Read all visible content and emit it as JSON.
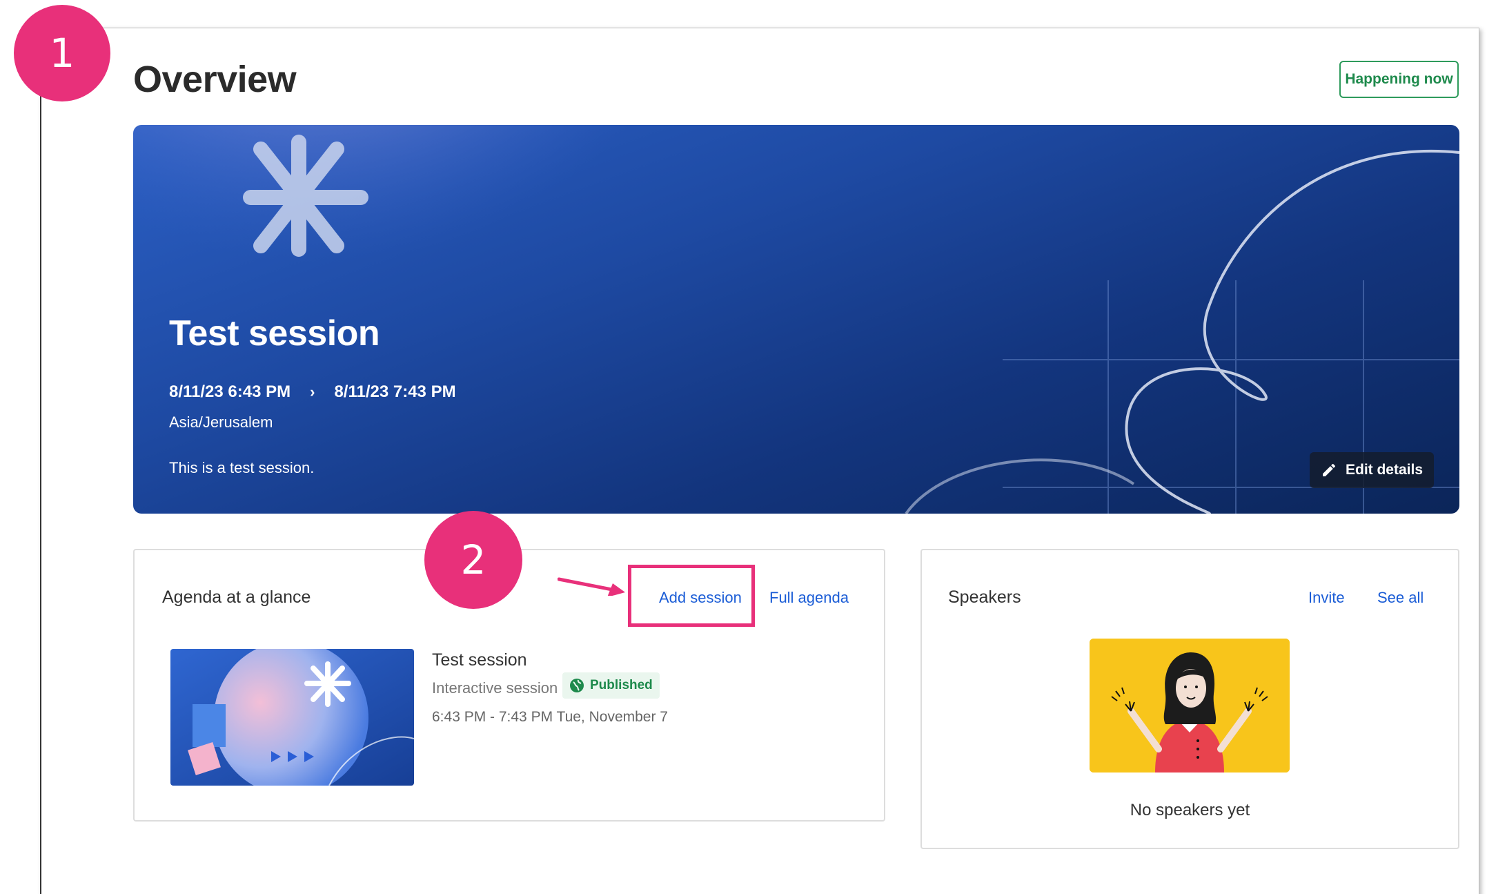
{
  "callouts": [
    "1",
    "2"
  ],
  "page": {
    "title": "Overview",
    "status_badge": "Happening now"
  },
  "banner": {
    "title": "Test session",
    "start": "8/11/23 6:43 PM",
    "end": "8/11/23 7:43 PM",
    "timezone": "Asia/Jerusalem",
    "description": "This is a test session.",
    "edit_label": "Edit details"
  },
  "agenda": {
    "title": "Agenda at a glance",
    "add_session_label": "Add session",
    "full_agenda_label": "Full agenda",
    "session": {
      "name": "Test session",
      "type": "Interactive session",
      "status": "Published",
      "time": "6:43 PM - 7:43 PM Tue, November 7"
    }
  },
  "speakers": {
    "title": "Speakers",
    "invite_label": "Invite",
    "see_all_label": "See all",
    "empty_text": "No speakers yet"
  },
  "colors": {
    "accent": "#e8307a",
    "link": "#1a5cd6",
    "success": "#1e8a4c",
    "banner": "#1e4aa3"
  }
}
